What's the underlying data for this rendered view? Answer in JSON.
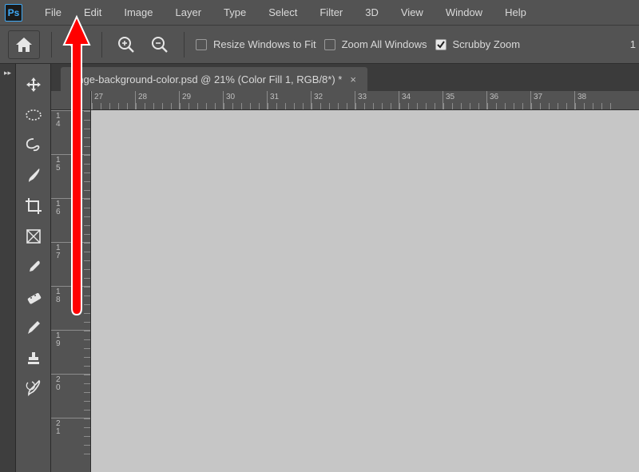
{
  "app_logo": "Ps",
  "menu": [
    "File",
    "Edit",
    "Image",
    "Layer",
    "Type",
    "Select",
    "Filter",
    "3D",
    "View",
    "Window",
    "Help"
  ],
  "options": {
    "resize_windows": {
      "label": "Resize Windows to Fit",
      "checked": false
    },
    "zoom_all": {
      "label": "Zoom All Windows",
      "checked": false
    },
    "scrubby": {
      "label": "Scrubby Zoom",
      "checked": true
    },
    "rate_value": "1"
  },
  "document_tab": {
    "title": "ange-background-color.psd @ 21% (Color Fill 1, RGB/8*) *"
  },
  "ruler_top": [
    "27",
    "28",
    "29",
    "30",
    "31",
    "32",
    "33",
    "34",
    "35",
    "36",
    "37",
    "38"
  ],
  "ruler_left": [
    "14",
    "15",
    "16",
    "17",
    "18",
    "19",
    "20",
    "21"
  ],
  "tool_names": [
    "move-tool",
    "marquee-ellipse-tool",
    "lasso-tool",
    "brush-tool",
    "crop-tool",
    "slice-tool",
    "eyedropper-tool",
    "ruler-tool",
    "pencil-tool",
    "stamp-tool",
    "history-brush-tool"
  ]
}
